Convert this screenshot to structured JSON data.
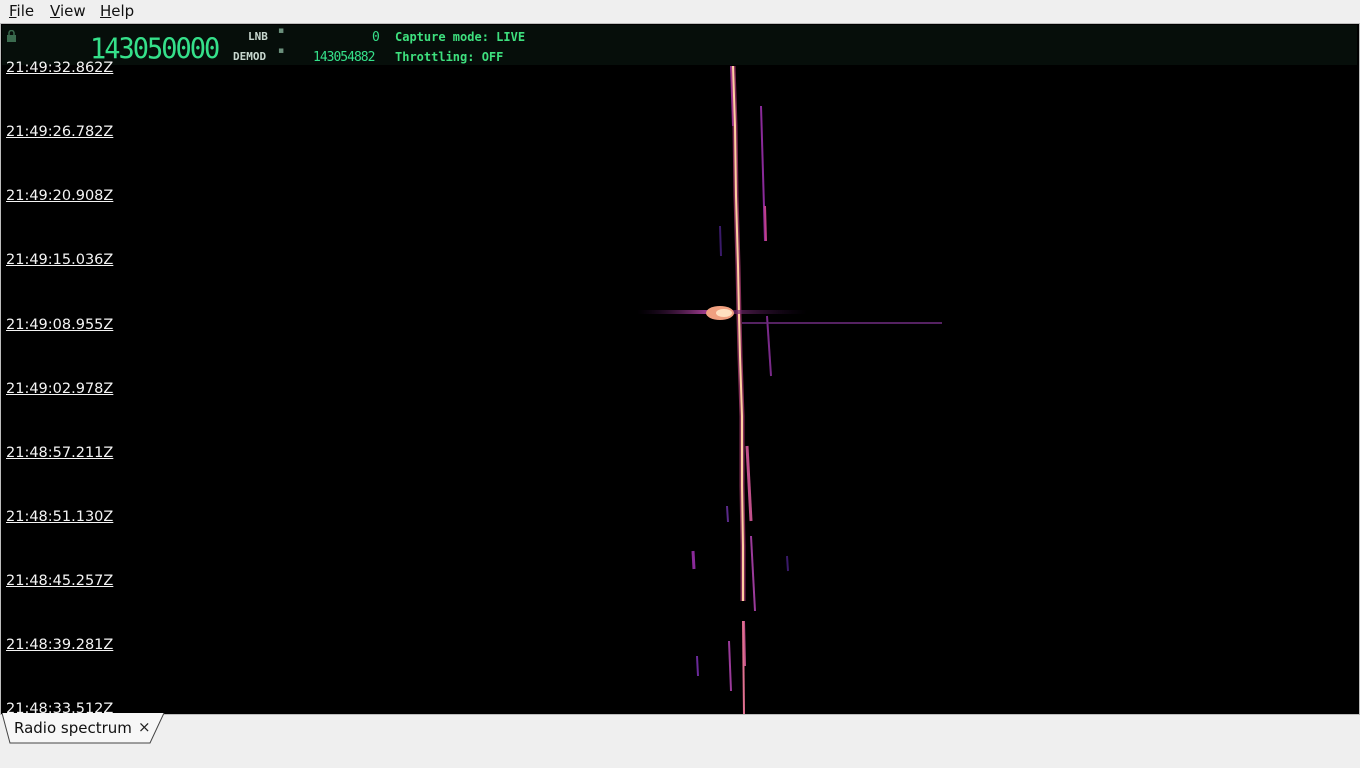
{
  "menu": {
    "file": "File",
    "view": "View",
    "help": "Help"
  },
  "status": {
    "main_frequency": "143050000",
    "lnb_label": "LNB",
    "demod_label": "DEMOD",
    "lnb_value": "0",
    "demod_value": "143054882",
    "capture_mode": "Capture mode: LIVE",
    "throttling": "Throttling: OFF"
  },
  "timestamps": [
    "21:49:32.862Z",
    "21:49:26.782Z",
    "21:49:20.908Z",
    "21:49:15.036Z",
    "21:49:08.955Z",
    "21:49:02.978Z",
    "21:48:57.211Z",
    "21:48:51.130Z",
    "21:48:45.257Z",
    "21:48:39.281Z",
    "21:48:33.512Z"
  ],
  "tab": {
    "label": "Radio spectrum",
    "close": "×"
  },
  "colors": {
    "lcd": "#35e08a",
    "signal_core": "#ffd8a0",
    "signal_mid": "#e8607a",
    "signal_low": "#6a2a8a",
    "background": "#000000"
  }
}
